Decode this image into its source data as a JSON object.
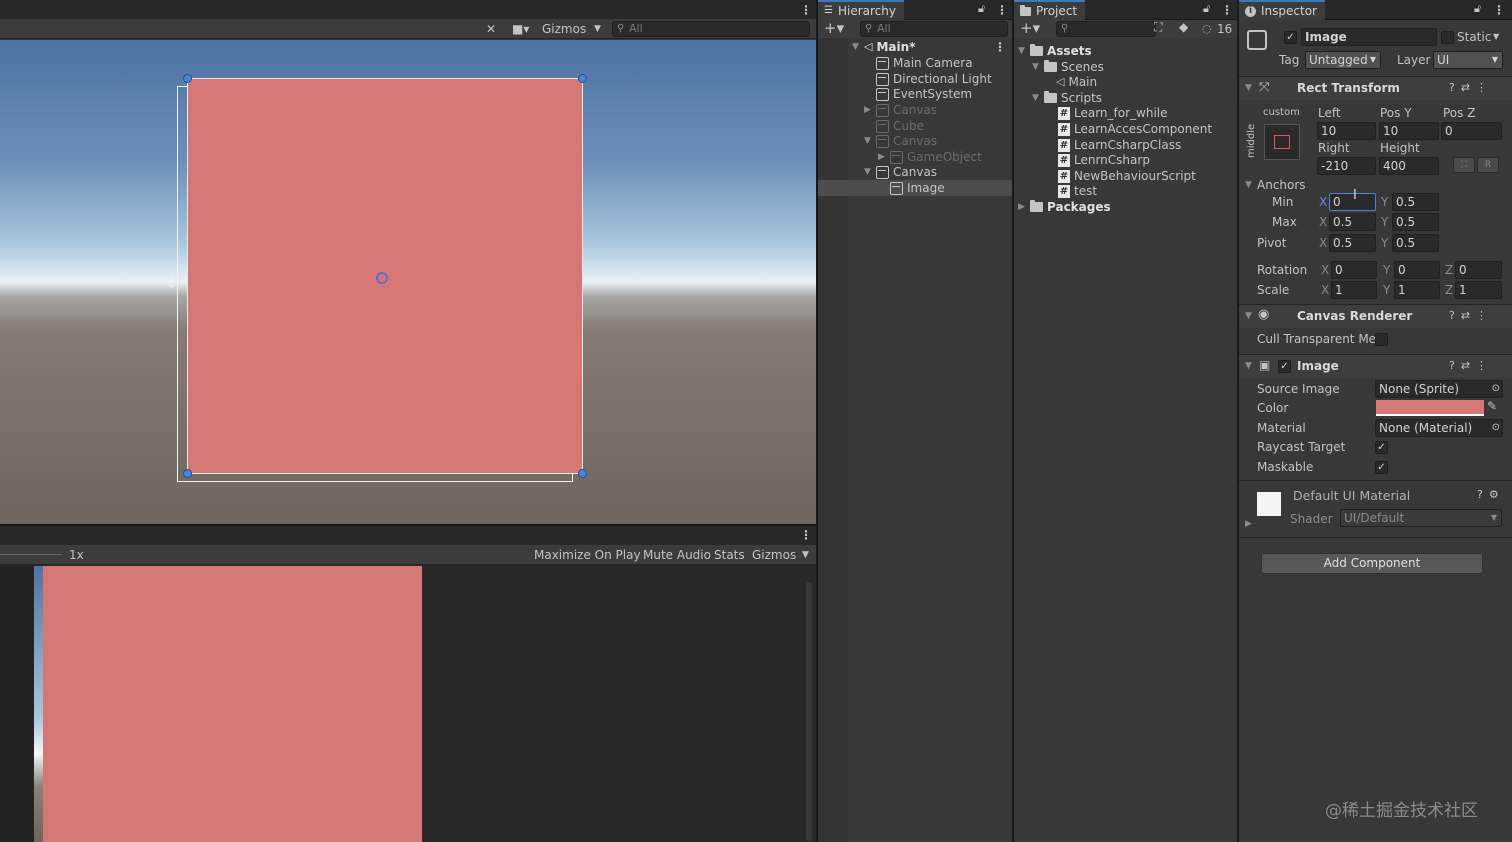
{
  "scene_view": {
    "gizmos_label": "Gizmos",
    "search_placeholder": "All"
  },
  "game_view": {
    "scale_label": "1x",
    "buttons": [
      "Maximize On Play",
      "Mute Audio",
      "Stats",
      "Gizmos"
    ]
  },
  "hierarchy": {
    "tab_label": "Hierarchy",
    "search_placeholder": "All",
    "items": [
      {
        "label": "Main*",
        "bold": true
      },
      {
        "label": "Main Camera"
      },
      {
        "label": "Directional Light"
      },
      {
        "label": "EventSystem"
      },
      {
        "label": "Canvas",
        "dim": true
      },
      {
        "label": "Cube",
        "dim": true
      },
      {
        "label": "Canvas",
        "dim": true
      },
      {
        "label": "GameObject",
        "dim": true
      },
      {
        "label": "Canvas"
      },
      {
        "label": "Image",
        "selected": true
      }
    ]
  },
  "project": {
    "tab_label": "Project",
    "hidden_count": "16",
    "items": [
      {
        "label": "Assets"
      },
      {
        "label": "Scenes"
      },
      {
        "label": "Main"
      },
      {
        "label": "Scripts"
      },
      {
        "label": "Learn_for_while"
      },
      {
        "label": "LearnAccesComponent"
      },
      {
        "label": "LearnCsharpClass"
      },
      {
        "label": "LenrnCsharp"
      },
      {
        "label": "NewBehaviourScript"
      },
      {
        "label": "test"
      },
      {
        "label": "Packages"
      }
    ]
  },
  "inspector": {
    "tab_label": "Inspector",
    "object_name": "Image",
    "static_label": "Static",
    "tag_label": "Tag",
    "tag_value": "Untagged",
    "layer_label": "Layer",
    "layer_value": "UI",
    "rect_transform": {
      "title": "Rect Transform",
      "anchor_preset_top": "custom",
      "anchor_preset_side": "middle",
      "left_label": "Left",
      "left": "10",
      "posy_label": "Pos Y",
      "posy": "10",
      "posz_label": "Pos Z",
      "posz": "0",
      "right_label": "Right",
      "right": "-210",
      "height_label": "Height",
      "height": "400",
      "r_button": "R",
      "anchors_label": "Anchors",
      "min_label": "Min",
      "min_x": "0",
      "min_y": "0.5",
      "max_label": "Max",
      "max_x": "0.5",
      "max_y": "0.5",
      "pivot_label": "Pivot",
      "pivot_x": "0.5",
      "pivot_y": "0.5",
      "rotation_label": "Rotation",
      "rot_x": "0",
      "rot_y": "0",
      "rot_z": "0",
      "scale_label": "Scale",
      "scale_x": "1",
      "scale_y": "1",
      "scale_z": "1",
      "axis_x": "X",
      "axis_y": "Y",
      "axis_z": "Z"
    },
    "canvas_renderer": {
      "title": "Canvas Renderer",
      "cull_label": "Cull Transparent Mes"
    },
    "image": {
      "title": "Image",
      "source_image_label": "Source Image",
      "source_image": "None (Sprite)",
      "color_label": "Color",
      "color_value": "#d47775",
      "material_label": "Material",
      "material": "None (Material)",
      "raycast_label": "Raycast Target",
      "maskable_label": "Maskable"
    },
    "material_preview": {
      "name": "Default UI Material",
      "shader_label": "Shader",
      "shader_value": "UI/Default"
    },
    "add_component": "Add Component"
  },
  "watermark": "@稀土掘金技术社区",
  "colors": {
    "accent": "#3a79bb",
    "image_pink": "#d47775"
  }
}
